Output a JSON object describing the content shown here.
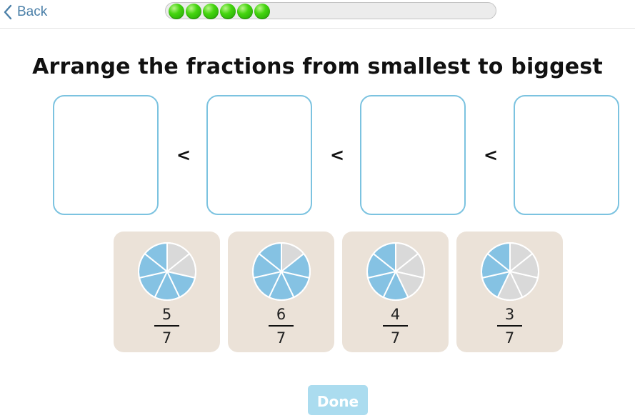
{
  "header": {
    "back_label": "Back",
    "back_icon": "chevron-left-icon",
    "progress": {
      "completed": 6,
      "dot_color": "#33c40c"
    }
  },
  "main": {
    "instruction": "Arrange the fractions from smallest to biggest",
    "slots": [
      {
        "value": ""
      },
      {
        "value": ""
      },
      {
        "value": ""
      },
      {
        "value": ""
      }
    ],
    "comparators": [
      "<",
      "<",
      "<"
    ],
    "slot_border_color": "#7cc3e0",
    "cards": [
      {
        "numerator": "5",
        "denominator": "7",
        "shaded": 5,
        "parts": 7
      },
      {
        "numerator": "6",
        "denominator": "7",
        "shaded": 6,
        "parts": 7
      },
      {
        "numerator": "4",
        "denominator": "7",
        "shaded": 4,
        "parts": 7
      },
      {
        "numerator": "3",
        "denominator": "7",
        "shaded": 3,
        "parts": 7
      }
    ],
    "colors": {
      "filled": "#85c2e3",
      "empty": "#d9d9d9",
      "card_bg": "#ebe2d8"
    }
  },
  "footer": {
    "done_label": "Done",
    "done_color": "#abdcef"
  }
}
